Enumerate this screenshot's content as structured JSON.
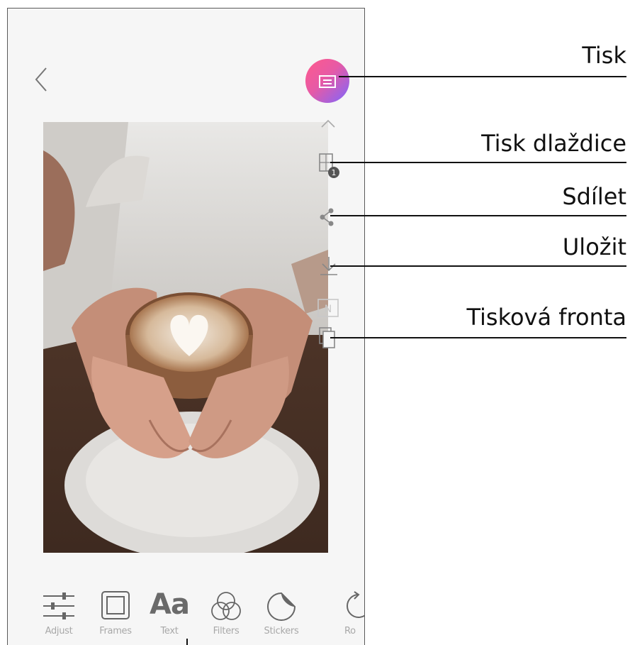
{
  "callouts": {
    "print": "Tisk",
    "tile_print": "Tisk dlaždice",
    "share": "Sdílet",
    "save": "Uložit",
    "print_queue": "Tisková fronta"
  },
  "toolbar": {
    "adjust": "Adjust",
    "frames": "Frames",
    "text": "Text",
    "text_glyph": "Aa",
    "filters": "Filters",
    "stickers": "Stickers",
    "rotate_partial": "Ro"
  },
  "side_icons": [
    "chevron-up-icon",
    "tile-print-icon",
    "share-icon",
    "save-icon",
    "nfc-icon",
    "print-queue-icon"
  ],
  "colors": {
    "print_gradient_start": "#ff5a8c",
    "print_gradient_end": "#7c66ff",
    "icon_gray": "#8a8a8a",
    "label_gray": "#a8a8a8"
  }
}
